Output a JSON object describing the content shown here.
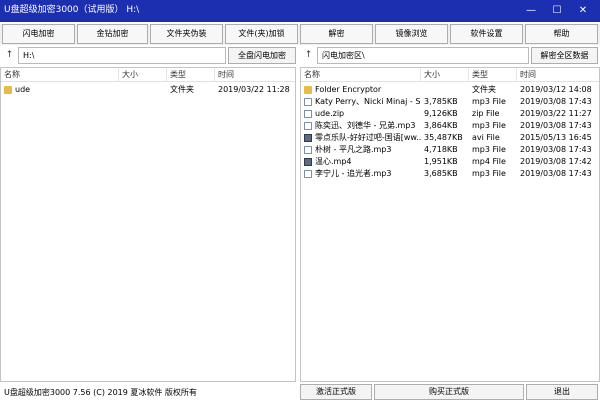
{
  "window": {
    "title": "U盘超级加密3000（试用版） H:\\",
    "minimize_glyph": "—",
    "maximize_glyph": "☐",
    "close_glyph": "✕"
  },
  "toolbar": {
    "buttons": [
      "闪电加密",
      "金钻加密",
      "文件夹伪装",
      "文件(夹)加锁",
      "解密",
      "镜像浏览",
      "软件设置",
      "帮助"
    ]
  },
  "left_pane": {
    "up_glyph": "↑",
    "path": "H:\\",
    "action_button": "全盘闪电加密",
    "columns": [
      "名称",
      "大小",
      "类型",
      "时间"
    ],
    "rows": [
      {
        "icon": "folder-icon",
        "name": "ude",
        "size": "",
        "type": "文件夹",
        "time": "2019/03/22 11:28"
      }
    ]
  },
  "right_pane": {
    "up_glyph": "↑",
    "path": "闪电加密区\\",
    "action_button": "解密全区数据",
    "columns": [
      "名称",
      "大小",
      "类型",
      "时间"
    ],
    "rows": [
      {
        "icon": "folder-icon",
        "name": "Folder Encryptor",
        "size": "",
        "type": "文件夹",
        "time": "2019/03/12 14:08"
      },
      {
        "icon": "file-icon",
        "name": "Katy Perry、Nicki Minaj - S...",
        "size": "3,785KB",
        "type": "mp3 File",
        "time": "2019/03/08 17:43"
      },
      {
        "icon": "file-icon",
        "name": "ude.zip",
        "size": "9,126KB",
        "type": "zip File",
        "time": "2019/03/22 11:27"
      },
      {
        "icon": "file-icon",
        "name": "陈奕迅、刘德华 - 兄弟.mp3",
        "size": "3,864KB",
        "type": "mp3 File",
        "time": "2019/03/08 17:43"
      },
      {
        "icon": "film-icon",
        "name": "零点乐队-好好过吧-国语[ww...",
        "size": "35,487KB",
        "type": "avi File",
        "time": "2015/05/13 16:45"
      },
      {
        "icon": "file-icon",
        "name": "朴树 - 平凡之路.mp3",
        "size": "4,718KB",
        "type": "mp3 File",
        "time": "2019/03/08 17:43"
      },
      {
        "icon": "film-icon",
        "name": "温心.mp4",
        "size": "1,951KB",
        "type": "mp4 File",
        "time": "2019/03/08 17:42"
      },
      {
        "icon": "file-icon",
        "name": "李宁儿 - 追光者.mp3",
        "size": "3,685KB",
        "type": "mp3 File",
        "time": "2019/03/08 17:43"
      }
    ]
  },
  "status": {
    "text": "U盘超级加密3000 7.56 (C) 2019 夏冰软件 版权所有",
    "buttons": [
      "激活正式版",
      "购买正式版",
      "退出"
    ]
  }
}
